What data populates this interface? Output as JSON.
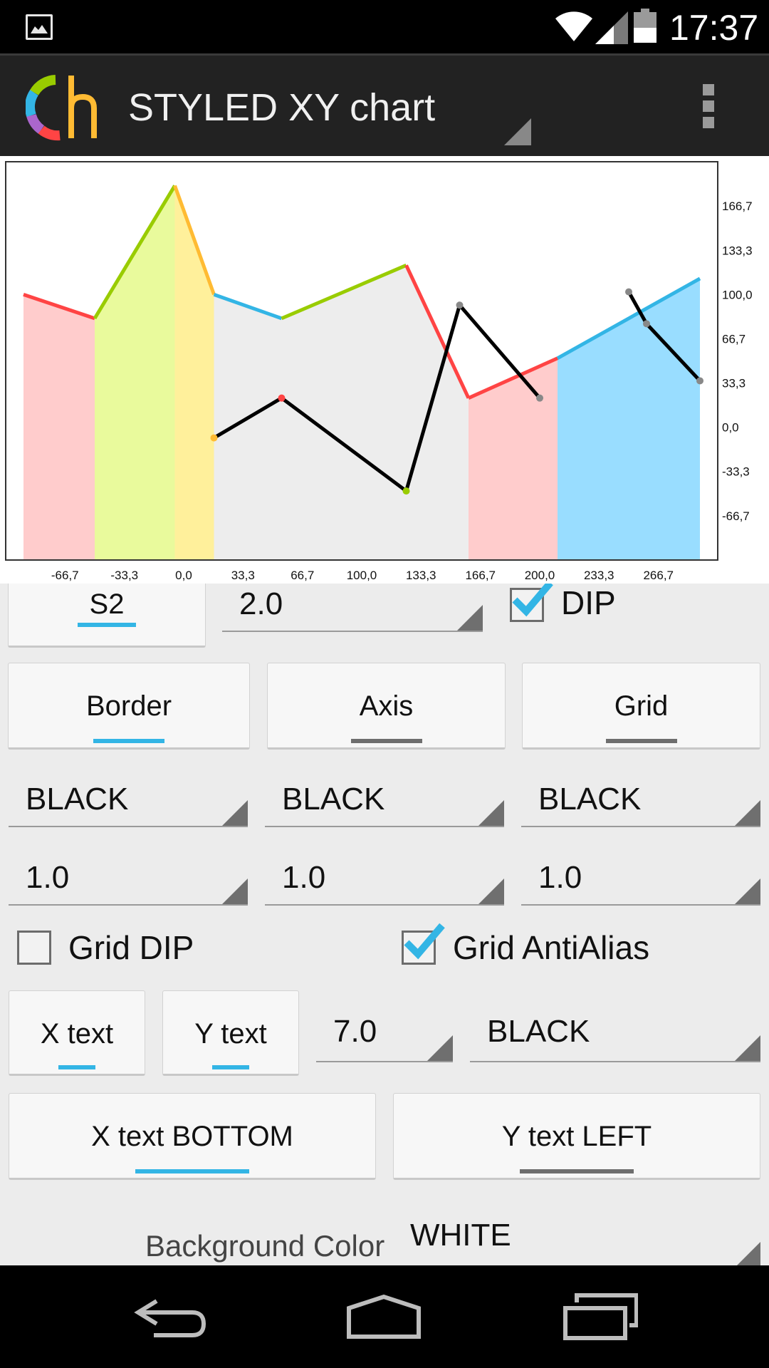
{
  "status_bar": {
    "time": "17:37",
    "battery_level_percent": 50,
    "icons": [
      "gallery-notification-icon",
      "wifi-icon",
      "cell-signal-icon",
      "battery-icon"
    ]
  },
  "action_bar": {
    "title": "STYLED XY chart",
    "logo_icon": "app-logo-icon",
    "overflow_icon": "overflow-menu-icon"
  },
  "chart_data": {
    "type": "line",
    "x_tick_labels": [
      "-66,7",
      "-33,3",
      "0,0",
      "33,3",
      "66,7",
      "100,0",
      "133,3",
      "166,7",
      "200,0",
      "233,3",
      "266,7"
    ],
    "y_tick_labels": [
      "166,7",
      "133,3",
      "100,0",
      "66,7",
      "33,3",
      "0,0",
      "-33,3",
      "-66,7"
    ],
    "xlim": [
      -100,
      300
    ],
    "ylim": [
      -100,
      200
    ],
    "grid": false,
    "colors": {
      "red": "#ff4444",
      "green": "#99cc00",
      "orange": "#ffbb33",
      "blue": "#33b5e5",
      "black": "#000000"
    },
    "series": [
      {
        "style": "filled segmented line",
        "points": [
          [
            -90,
            100
          ],
          [
            -50,
            82
          ],
          [
            -5,
            182
          ],
          [
            17,
            100
          ],
          [
            55,
            82
          ],
          [
            125,
            122
          ],
          [
            160,
            22
          ],
          [
            210,
            52
          ],
          [
            290,
            112
          ]
        ],
        "segment_colors": [
          "red",
          "green",
          "orange",
          "blue",
          "green",
          "red",
          "red",
          "blue"
        ],
        "fill_colors": [
          "#ffcccc",
          "#e9fa9c",
          "#fff09b",
          "#ededed",
          "#ededed",
          "#ededed",
          "#ffcccc",
          "#99ddff"
        ]
      },
      {
        "style": "line",
        "points": [
          [
            17,
            -8
          ],
          [
            55,
            22
          ],
          [
            125,
            -48
          ],
          [
            155,
            92
          ],
          [
            200,
            22
          ]
        ],
        "point_colors": [
          "orange",
          "red",
          "green",
          "gray",
          "gray"
        ]
      },
      {
        "style": "line",
        "points": [
          [
            250,
            102
          ],
          [
            260,
            78
          ],
          [
            290,
            35
          ]
        ],
        "point_colors": [
          "gray",
          "gray",
          "gray"
        ]
      }
    ]
  },
  "controls": {
    "row1": {
      "series_button": "S2",
      "width_value": "2.0",
      "dip_label": "DIP",
      "dip_checked": true
    },
    "row2": {
      "border_button": "Border",
      "axis_button": "Axis",
      "grid_button": "Grid"
    },
    "row3": {
      "border_color": "BLACK",
      "axis_color": "BLACK",
      "grid_color": "BLACK"
    },
    "row4": {
      "border_width": "1.0",
      "axis_width": "1.0",
      "grid_width": "1.0"
    },
    "row5": {
      "grid_dip_label": "Grid DIP",
      "grid_dip_checked": false,
      "grid_antialias_label": "Grid AntiAlias",
      "grid_antialias_checked": true
    },
    "row6": {
      "x_text_button": "X text",
      "y_text_button": "Y text",
      "text_size": "7.0",
      "text_color": "BLACK"
    },
    "row7": {
      "x_text_position_button": "X text BOTTOM",
      "y_text_position_button": "Y text LEFT"
    },
    "row8": {
      "background_label": "Background Color",
      "background_value": "WHITE"
    }
  },
  "nav_bar": {
    "icons": [
      "back-icon",
      "home-icon",
      "recent-apps-icon"
    ]
  }
}
